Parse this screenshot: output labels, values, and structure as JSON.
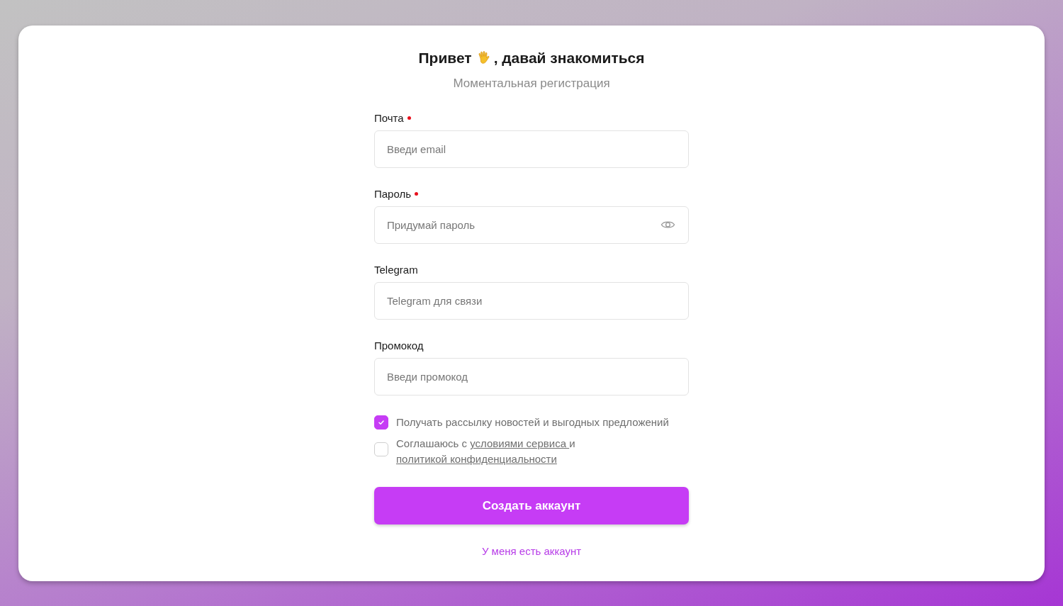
{
  "heading": {
    "text_before": "Привет",
    "text_after": ", давай знакомиться"
  },
  "subtitle": "Моментальная регистрация",
  "fields": [
    {
      "label": "Почта",
      "required": true,
      "placeholder": "Введи email",
      "kind": "text"
    },
    {
      "label": "Пароль",
      "required": true,
      "placeholder": "Придумай пароль",
      "kind": "password"
    },
    {
      "label": "Telegram",
      "required": false,
      "placeholder": "Telegram для связи",
      "kind": "text"
    },
    {
      "label": "Промокод",
      "required": false,
      "placeholder": "Введи промокод",
      "kind": "text"
    }
  ],
  "checkboxes": [
    {
      "checked": true,
      "parts": [
        {
          "kind": "text",
          "text": "Получать рассылку новостей и выгодных предложений"
        }
      ]
    },
    {
      "checked": false,
      "parts": [
        {
          "kind": "text",
          "text": "Соглашаюсь с "
        },
        {
          "kind": "link",
          "text": "условиями сервиса "
        },
        {
          "kind": "text",
          "text": "и "
        },
        {
          "kind": "link",
          "text": "политикой конфиденциальности"
        }
      ]
    }
  ],
  "submit_button": "Создать аккаунт",
  "login_link": "У меня есть аккаунт"
}
